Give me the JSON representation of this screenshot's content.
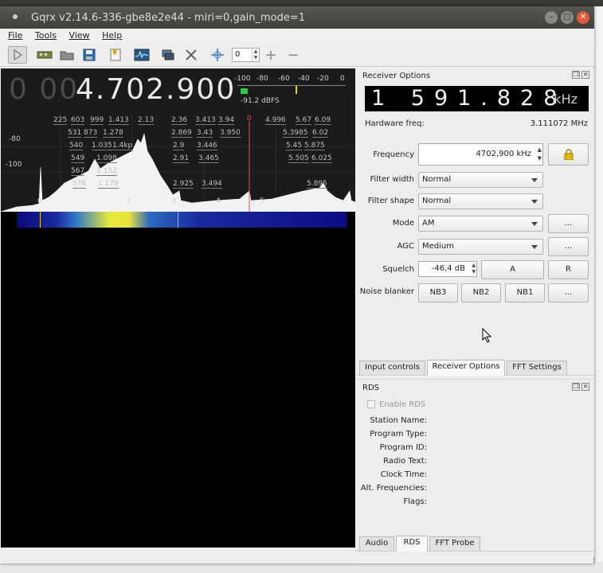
{
  "window": {
    "title": "Gqrx v2.14.6-336-gbe8e2e44 - miri=0,gain_mode=1"
  },
  "menu": {
    "file": "File",
    "tools": "Tools",
    "view": "View",
    "help": "Help"
  },
  "toolbar": {
    "spin_value": "0",
    "icons": [
      "play-icon",
      "hardware-icon",
      "open-folder-icon",
      "save-icon",
      "bookmark-icon",
      "spectrum-icon",
      "remote-icon",
      "tools-icon",
      "center-icon"
    ]
  },
  "display": {
    "freq_dim": "0 00",
    "freq_main": "4.702.900",
    "smeter_scale": [
      "-100",
      "-80",
      "-60",
      "-40",
      "-20",
      "0"
    ],
    "smeter_value": "-91.2 dBFS",
    "smeter_level_fraction": 0.07
  },
  "spectrum": {
    "y_labels": [
      "-80",
      "-100"
    ],
    "x_labels": [
      "0",
      "2",
      "3",
      "4",
      "5"
    ],
    "station_labels": [
      "225",
      "603",
      "999",
      "1.413",
      "2.13",
      "2.36",
      "3.413",
      "3.94",
      "4.996",
      "5.67",
      "6.09",
      "531",
      "873",
      "1.278",
      "2.869",
      "3.43",
      "3.950",
      "5.3985",
      "6.02",
      "540",
      "1.035",
      "1.4kp",
      "2.9",
      "3.446",
      "5.45",
      "5.875",
      "549",
      "1.098",
      "2.91",
      "3.465",
      "5.505",
      "6.025",
      "567",
      "1.152",
      "576",
      "1.179",
      "2.925",
      "3.494",
      "5.895"
    ]
  },
  "receiver": {
    "title": "Receiver Options",
    "freq_digits": "1 591.828",
    "freq_unit": "kHz",
    "hw_label": "Hardware freq:",
    "hw_value": "3.111072 MHz",
    "frequency_label": "Frequency",
    "frequency_value": "4702,900 kHz",
    "filter_width_label": "Filter width",
    "filter_width_value": "Normal",
    "filter_shape_label": "Filter shape",
    "filter_shape_value": "Normal",
    "mode_label": "Mode",
    "mode_value": "AM",
    "agc_label": "AGC",
    "agc_value": "Medium",
    "squelch_label": "Squelch",
    "squelch_value": "-46,4 dB",
    "squelch_a": "A",
    "squelch_r": "R",
    "nb_label": "Noise blanker",
    "nb3": "NB3",
    "nb2": "NB2",
    "nb1": "NB1",
    "more": "..."
  },
  "tabs_top": [
    "Input controls",
    "Receiver Options",
    "FFT Settings"
  ],
  "rds": {
    "title": "RDS",
    "enable": "Enable RDS",
    "fields": [
      "Station Name:",
      "Program Type:",
      "Program ID:",
      "Radio Text:",
      "Clock Time:",
      "Alt. Frequencies:",
      "Flags:"
    ]
  },
  "tabs_bottom": [
    "Audio",
    "RDS",
    "FFT Probe"
  ]
}
